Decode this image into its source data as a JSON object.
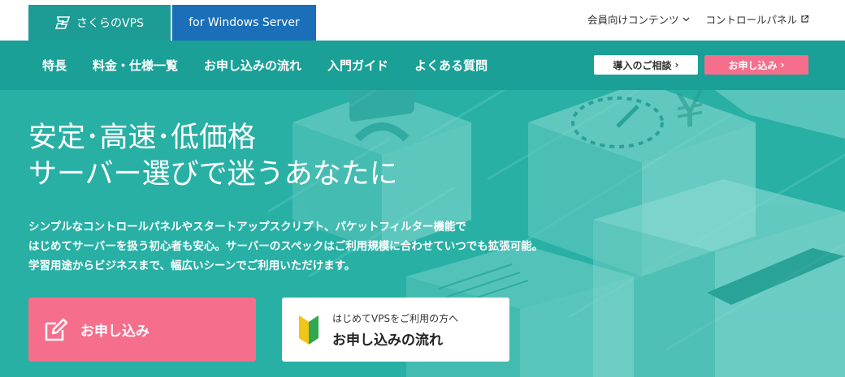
{
  "header": {
    "tab_vps": "さくらのVPS",
    "tab_windows": "for Windows Server",
    "member_contents": "会員向けコンテンツ",
    "control_panel": "コントロールパネル"
  },
  "nav": {
    "items": [
      "特長",
      "料金・仕様一覧",
      "お申し込みの流れ",
      "入門ガイド",
      "よくある質問"
    ],
    "consult_button": "導入のご相談",
    "apply_button": "お申し込み"
  },
  "hero": {
    "title_line1": "安定･高速･低価格",
    "title_line2": "サーバー選びで迷うあなたに",
    "desc_line1": "シンプルなコントロールパネルやスタートアップスクリプト、パケットフィルター機能で",
    "desc_line2": "はじめてサーバーを扱う初心者も安心。サーバーのスペックはご利用規模に合わせていつでも拡張可能。",
    "desc_line3": "学習用途からビジネスまで、幅広いシーンでご利用いただけます。"
  },
  "cta": {
    "apply_label": "お申し込み",
    "flow_sub": "はじめてVPSをご利用の方へ",
    "flow_main": "お申し込みの流れ"
  },
  "colors": {
    "teal": "#1aa096",
    "hero_teal": "#28b0a5",
    "windows_blue": "#1b6fb8",
    "pink": "#f56e8c"
  },
  "icons": [
    "sakura-logo-icon",
    "chevron-down-icon",
    "external-link-icon",
    "chevron-right-icon",
    "edit-pencil-icon",
    "beginner-mark-icon"
  ]
}
